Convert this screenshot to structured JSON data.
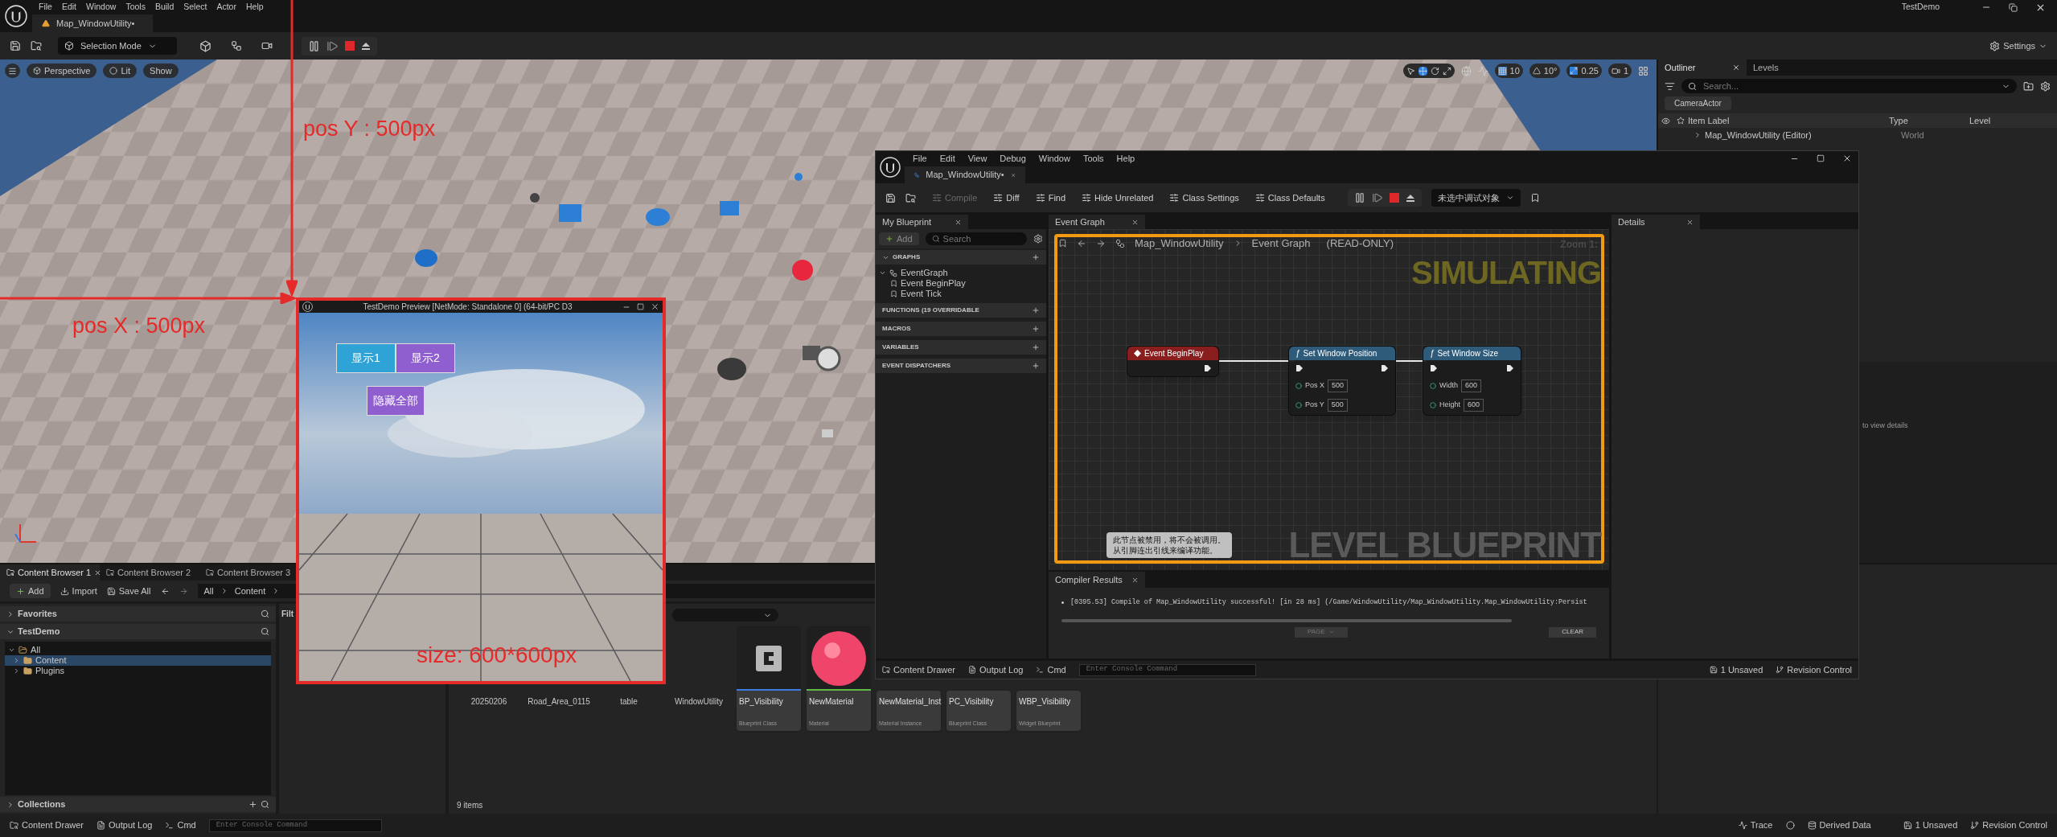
{
  "main_menu": [
    "File",
    "Edit",
    "Window",
    "Tools",
    "Build",
    "Select",
    "Actor",
    "Help"
  ],
  "app_title": "TestDemo",
  "level_tab": {
    "label": "Map_WindowUtility•"
  },
  "toolbar": {
    "mode": "Selection Mode",
    "settings": "Settings"
  },
  "viewport": {
    "buttons": [
      "Perspective",
      "Lit",
      "Show"
    ],
    "grid": "10",
    "angle": "10°",
    "scale": "0.25",
    "camera": "1"
  },
  "outliner": {
    "tabs": [
      {
        "label": "Outliner",
        "selected": true
      },
      {
        "label": "Levels",
        "selected": false
      }
    ],
    "search_placeholder": "Search...",
    "filter_chip": "CameraActor",
    "columns": [
      "Item Label",
      "Type",
      "Level"
    ],
    "rows": [
      {
        "label": "Map_WindowUtility (Editor)",
        "type": "World",
        "expanded": false
      }
    ]
  },
  "details_hint": "to view details",
  "content_browser": {
    "tabs": [
      {
        "label": "Content Browser 1",
        "selected": true
      },
      {
        "label": "Content Browser 2",
        "selected": false
      },
      {
        "label": "Content Browser 3",
        "selected": false
      }
    ],
    "actions": [
      "Add",
      "Import",
      "Save All"
    ],
    "breadcrumb": [
      "All",
      "Content"
    ],
    "sections": [
      {
        "label": "Favorites",
        "expanded": false
      },
      {
        "label": "TestDemo",
        "expanded": true
      }
    ],
    "tree": {
      "label": "All",
      "expanded": true,
      "children": [
        {
          "label": "Content",
          "selected": true
        },
        {
          "label": "Plugins",
          "selected": false
        }
      ]
    },
    "collections": "Collections",
    "filter_label": "Filt",
    "assets": [
      {
        "kind": "folder",
        "name": "20250206"
      },
      {
        "kind": "folder",
        "name": "Road_Area_0115"
      },
      {
        "kind": "folder",
        "name": "table"
      },
      {
        "kind": "folder",
        "name": "WindowUtility"
      },
      {
        "kind": "blueprint",
        "name": "BP_Visibility",
        "type": "Blueprint Class",
        "color": "#3d7be0"
      },
      {
        "kind": "material",
        "name": "NewMaterial",
        "type": "Material",
        "color": "#5fba45"
      },
      {
        "kind": "asset",
        "name": "NewMaterial_Inst",
        "type": "Material Instance"
      },
      {
        "kind": "asset",
        "name": "PC_Visibility",
        "type": "Blueprint Class"
      },
      {
        "kind": "asset",
        "name": "WBP_Visibility",
        "type": "Widget Blueprint"
      }
    ],
    "item_count": "9 items"
  },
  "status_bar": {
    "drawer": "Content Drawer",
    "log": "Output Log",
    "cmd": "Cmd",
    "console_placeholder": "Enter Console Command",
    "trace": "Trace",
    "derived": "Derived Data",
    "unsaved": "1 Unsaved",
    "revision": "Revision Control"
  },
  "blueprint_window": {
    "menu": [
      "File",
      "Edit",
      "View",
      "Debug",
      "Window",
      "Tools",
      "Help"
    ],
    "tab": "Map_WindowUtility•",
    "toolbar": [
      {
        "label": "Compile",
        "disabled": true
      },
      {
        "label": "Diff",
        "disabled": false
      },
      {
        "label": "Find",
        "disabled": false
      },
      {
        "label": "Hide Unrelated",
        "disabled": false
      },
      {
        "label": "Class Settings",
        "disabled": false
      },
      {
        "label": "Class Defaults",
        "disabled": false
      }
    ],
    "debug_object": "未选中调试对象",
    "my_blueprint": {
      "title": "My Blueprint",
      "add": "Add",
      "search_placeholder": "Search",
      "graphs": {
        "label": "GRAPHS",
        "tree": {
          "label": "EventGraph",
          "expanded": true,
          "children": [
            "Event BeginPlay",
            "Event Tick"
          ]
        }
      },
      "sections": [
        "FUNCTIONS (19 OVERRIDABLE",
        "MACROS",
        "VARIABLES",
        "EVENT DISPATCHERS"
      ]
    },
    "graph": {
      "tab": "Event Graph",
      "path": [
        "Map_WindowUtility",
        "Event Graph"
      ],
      "mode": "(READ-ONLY)",
      "zoom": "Zoom 1:",
      "banner": "SIMULATING",
      "watermark": "LEVEL BLUEPRINT",
      "nodes": [
        {
          "kind": "event",
          "title": "Event BeginPlay"
        },
        {
          "kind": "function",
          "icon": "ƒ",
          "title": "Set Window Position",
          "pins": [
            {
              "label": "Pos X",
              "value": "500"
            },
            {
              "label": "Pos Y",
              "value": "500"
            }
          ]
        },
        {
          "kind": "function",
          "icon": "ƒ",
          "title": "Set Window Size",
          "pins": [
            {
              "label": "Width",
              "value": "600"
            },
            {
              "label": "Height",
              "value": "600"
            }
          ]
        }
      ],
      "comment": [
        "此节点被禁用，将不会被调用。",
        "从引脚连出引线来编译功能。"
      ]
    },
    "compiler": {
      "tab": "Compiler Results",
      "message": "[0395.53] Compile of Map_WindowUtility successful! [in 28 ms] (/Game/WindowUtility/Map_WindowUtility.Map_WindowUtility:Persist",
      "page": "PAGE",
      "clear": "CLEAR"
    },
    "details_tab": "Details",
    "status": {
      "drawer": "Content Drawer",
      "log": "Output Log",
      "cmd": "Cmd",
      "console_placeholder": "Enter Console Command",
      "unsaved": "1 Unsaved",
      "revision": "Revision Control"
    }
  },
  "preview_window": {
    "title": "TestDemo Preview [NetMode: Standalone 0]  (64-bit/PC D3",
    "buttons": [
      {
        "label": "显示1",
        "color": "#2fa3d6"
      },
      {
        "label": "显示2",
        "color": "#8f5fd0"
      },
      {
        "label": "隐藏全部",
        "color": "#8f5fd0"
      }
    ]
  },
  "annotations": [
    {
      "kind": "arrow_down",
      "label": "pos Y : 500px"
    },
    {
      "kind": "arrow_right",
      "label": "pos X : 500px"
    },
    {
      "kind": "size",
      "label": "size: 600*600px"
    }
  ]
}
